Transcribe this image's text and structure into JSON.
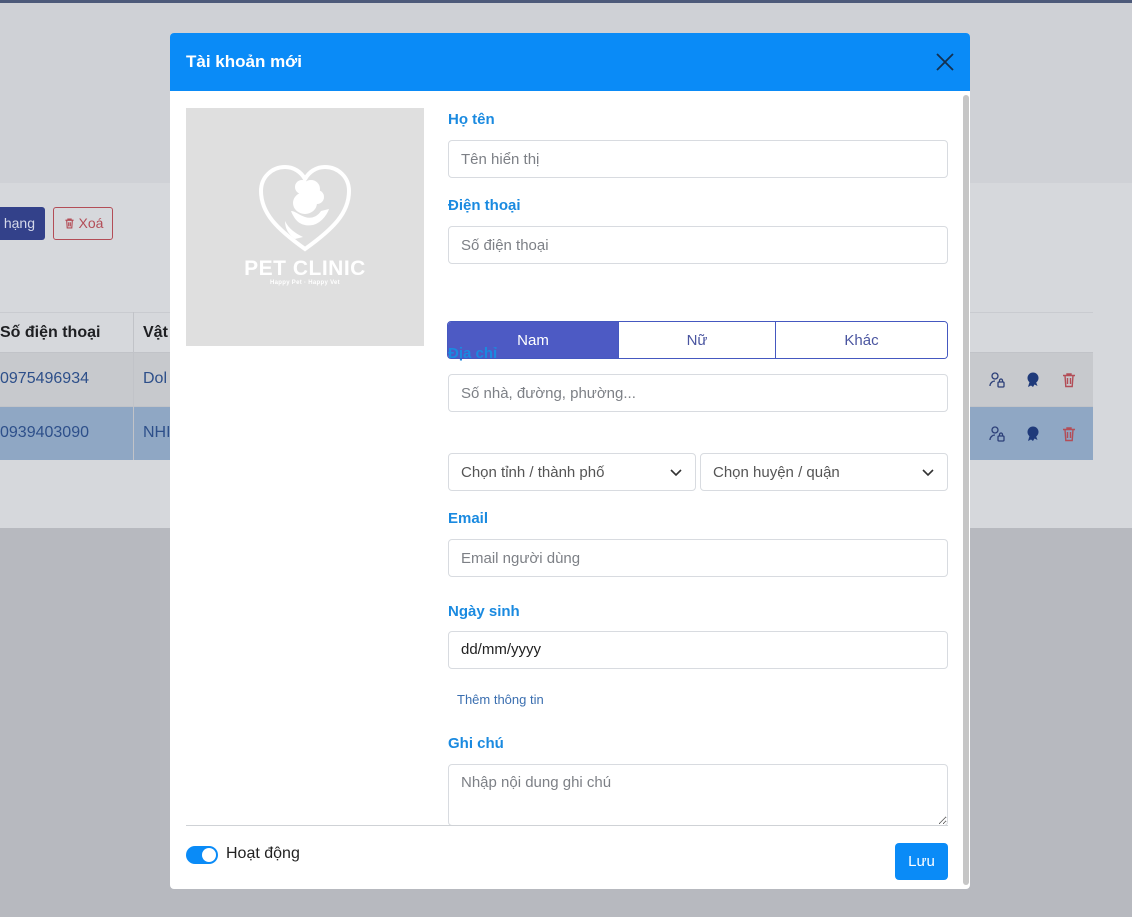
{
  "background": {
    "toolbar": {
      "rank_button_label": "t hạng",
      "delete_button_label": "Xoá"
    },
    "table": {
      "columns": [
        "Số điện thoại",
        "Vật"
      ],
      "rows": [
        {
          "phone": "0975496934",
          "pet": "Dol"
        },
        {
          "phone": "0939403090",
          "pet": "NHI"
        }
      ]
    }
  },
  "modal": {
    "title": "Tài khoản mới",
    "logo": {
      "name": "PET CLINIC",
      "tagline": "Happy Pet · Happy Vet"
    },
    "fields": {
      "name": {
        "label": "Họ tên",
        "placeholder": "Tên hiển thị"
      },
      "phone": {
        "label": "Điện thoại",
        "placeholder": "Số điện thoại"
      },
      "gender": {
        "options": [
          "Nam",
          "Nữ",
          "Khác"
        ],
        "selected": "Nam"
      },
      "address": {
        "label": "Địa chỉ",
        "placeholder": "Số nhà, đường, phường...",
        "province_select": "Chọn tỉnh / thành phố",
        "district_select": "Chọn huyện / quận"
      },
      "email": {
        "label": "Email",
        "placeholder": "Email người dùng"
      },
      "birthday": {
        "label": "Ngày sinh",
        "value": "dd/mm/yyyy"
      },
      "more_info_link": "Thêm thông tin",
      "note": {
        "label": "Ghi chú",
        "placeholder": "Nhập nội dung ghi chú"
      }
    },
    "footer": {
      "active_label": "Hoạt động",
      "active": true,
      "save_label": "Lưu"
    }
  },
  "colors": {
    "primary": "#0a8bf7",
    "label": "#1a8ae0",
    "gender_active": "#4d5ac4",
    "danger": "#b34d57"
  }
}
